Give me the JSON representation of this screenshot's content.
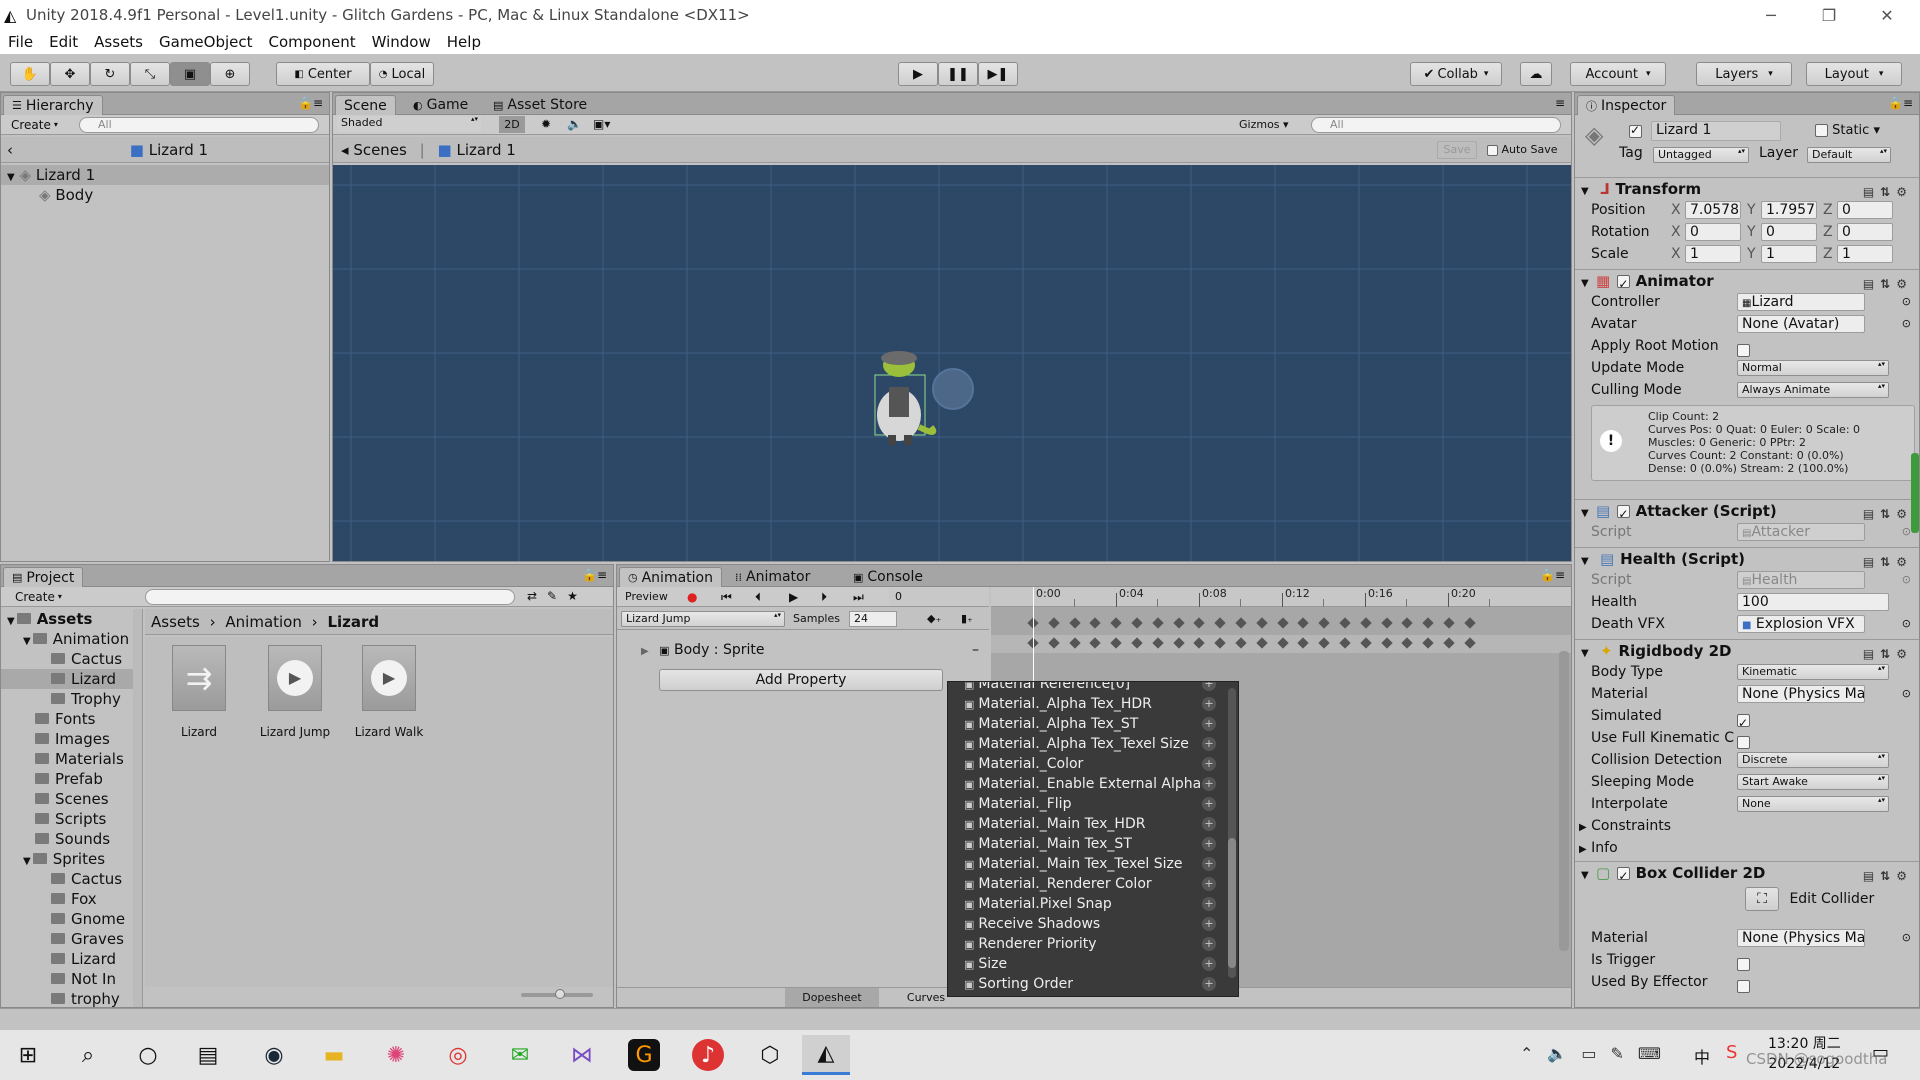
{
  "window": {
    "title": "Unity 2018.4.9f1 Personal - Level1.unity - Glitch Gardens - PC, Mac & Linux Standalone <DX11>"
  },
  "menu": [
    "File",
    "Edit",
    "Assets",
    "GameObject",
    "Component",
    "Window",
    "Help"
  ],
  "toolbar": {
    "pivot": "Center",
    "space": "Local",
    "collab": "Collab",
    "account": "Account",
    "layers": "Layers",
    "layout": "Layout"
  },
  "hierarchy": {
    "tab": "Hierarchy",
    "create": "Create",
    "search_placeholder": "All",
    "breadcrumb": "Lizard 1",
    "items": [
      "Lizard 1",
      "Body"
    ]
  },
  "scene": {
    "tabs": [
      "Scene",
      "Game",
      "Asset Store"
    ],
    "shading": "Shaded",
    "mode2d": "2D",
    "gizmos": "Gizmos",
    "search_placeholder": "All",
    "breadcrumb": [
      "Scenes",
      "Lizard 1"
    ],
    "save": "Save",
    "auto_save": "Auto Save",
    "bg_color": "#2d4766"
  },
  "project": {
    "tab": "Project",
    "create": "Create",
    "tree": [
      {
        "label": "Assets",
        "indent": 0,
        "bold": true
      },
      {
        "label": "Animation",
        "indent": 1
      },
      {
        "label": "Cactus",
        "indent": 2
      },
      {
        "label": "Lizard",
        "indent": 2,
        "selected": true
      },
      {
        "label": "Trophy",
        "indent": 2
      },
      {
        "label": "Fonts",
        "indent": 1
      },
      {
        "label": "Images",
        "indent": 1
      },
      {
        "label": "Materials",
        "indent": 1
      },
      {
        "label": "Prefab",
        "indent": 1
      },
      {
        "label": "Scenes",
        "indent": 1
      },
      {
        "label": "Scripts",
        "indent": 1
      },
      {
        "label": "Sounds",
        "indent": 1
      },
      {
        "label": "Sprites",
        "indent": 1
      },
      {
        "label": "Cactus",
        "indent": 2
      },
      {
        "label": "Fox",
        "indent": 2
      },
      {
        "label": "Gnome",
        "indent": 2
      },
      {
        "label": "Graves",
        "indent": 2
      },
      {
        "label": "Lizard",
        "indent": 2
      },
      {
        "label": "Not In",
        "indent": 2
      },
      {
        "label": "trophy",
        "indent": 2
      }
    ],
    "path": [
      "Assets",
      "Animation",
      "Lizard"
    ],
    "assets": [
      "Lizard",
      "Lizard Jump",
      "Lizard Walk"
    ]
  },
  "animation": {
    "tabs": [
      "Animation",
      "Animator",
      "Console"
    ],
    "preview": "Preview",
    "frame": "0",
    "clip": "Lizard Jump",
    "samples_label": "Samples",
    "samples": "24",
    "ruler": [
      "0:00",
      "0:04",
      "0:08",
      "0:12",
      "0:16",
      "0:20"
    ],
    "property": "Body : Sprite",
    "add_property": "Add Property",
    "dopesheet": "Dopesheet",
    "curves": "Curves",
    "dropdown_items": [
      "Material Reference[0]",
      "Material._Alpha Tex_HDR",
      "Material._Alpha Tex_ST",
      "Material._Alpha Tex_Texel Size",
      "Material._Color",
      "Material._Enable External Alpha",
      "Material._Flip",
      "Material._Main Tex_HDR",
      "Material._Main Tex_ST",
      "Material._Main Tex_Texel Size",
      "Material._Renderer Color",
      "Material.Pixel Snap",
      "Receive Shadows",
      "Renderer Priority",
      "Size",
      "Sorting Order"
    ]
  },
  "inspector": {
    "tab": "Inspector",
    "object_name": "Lizard 1",
    "static": "Static",
    "tag_label": "Tag",
    "tag": "Untagged",
    "layer_label": "Layer",
    "layer": "Default",
    "transform": {
      "title": "Transform",
      "position_label": "Position",
      "rotation_label": "Rotation",
      "scale_label": "Scale",
      "position": [
        "7.0578",
        "1.7957",
        "0"
      ],
      "rotation": [
        "0",
        "0",
        "0"
      ],
      "scale": [
        "1",
        "1",
        "1"
      ]
    },
    "animator": {
      "title": "Animator",
      "controller_label": "Controller",
      "controller": "Lizard",
      "avatar_label": "Avatar",
      "avatar": "None (Avatar)",
      "apply_root_motion": "Apply Root Motion",
      "update_mode_label": "Update Mode",
      "update_mode": "Normal",
      "culling_mode_label": "Culling Mode",
      "culling_mode": "Always Animate",
      "info": [
        "Clip Count: 2",
        "Curves Pos: 0 Quat: 0 Euler: 0 Scale: 0",
        "Muscles: 0 Generic: 0 PPtr: 2",
        "Curves Count: 2 Constant: 0 (0.0%)",
        "Dense: 0 (0.0%) Stream: 2 (100.0%)"
      ]
    },
    "attacker": {
      "title": "Attacker (Script)",
      "script_label": "Script",
      "script": "Attacker"
    },
    "health": {
      "title": "Health (Script)",
      "script_label": "Script",
      "script": "Health",
      "health_label": "Health",
      "health": "100",
      "death_vfx_label": "Death VFX",
      "death_vfx": "Explosion VFX"
    },
    "rigidbody": {
      "title": "Rigidbody 2D",
      "body_type_label": "Body Type",
      "body_type": "Kinematic",
      "material_label": "Material",
      "material": "None (Physics Mat",
      "simulated_label": "Simulated",
      "full_kinematic_label": "Use Full Kinematic Co",
      "collision_label": "Collision Detection",
      "collision": "Discrete",
      "sleeping_label": "Sleeping Mode",
      "sleeping": "Start Awake",
      "interpolate_label": "Interpolate",
      "interpolate": "None",
      "constraints": "Constraints",
      "info": "Info"
    },
    "boxcollider": {
      "title": "Box Collider 2D",
      "edit_collider": "Edit Collider",
      "material_label": "Material",
      "material": "None (Physics Mat",
      "is_trigger_label": "Is Trigger",
      "used_by_effector_label": "Used By Effector"
    }
  },
  "taskbar": {
    "time": "13:20 周二",
    "date": "2022/4/12",
    "ime": "中",
    "watermark": "CSDN @sogoodtha"
  }
}
